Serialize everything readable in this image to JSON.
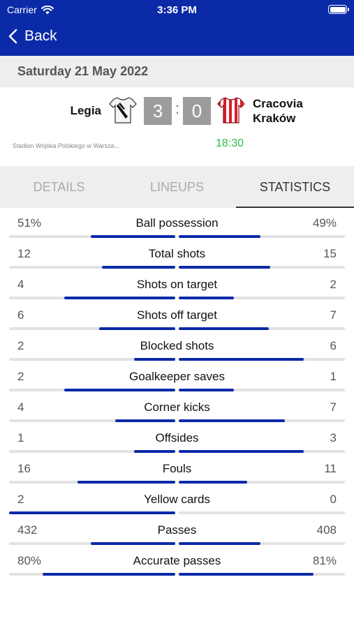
{
  "status_bar": {
    "carrier": "Carrier",
    "time": "3:36 PM"
  },
  "nav": {
    "back_label": "Back"
  },
  "match": {
    "date": "Saturday 21 May 2022",
    "home_team": "Legia",
    "away_team": "Cracovia Kraków",
    "home_score": "3",
    "away_score": "0",
    "separator": ":",
    "stadium": "Stadion Wojska Polskiego w Warsza...",
    "kickoff": "18:30"
  },
  "tabs": [
    {
      "label": "DETAILS",
      "active": false
    },
    {
      "label": "LINEUPS",
      "active": false
    },
    {
      "label": "STATISTICS",
      "active": true
    }
  ],
  "colors": {
    "brand": "#0a2aa8",
    "kickoff_green": "#2ebd4a",
    "score_box": "#9c9c9c"
  },
  "statistics": [
    {
      "label": "Ball possession",
      "home": "51%",
      "away": "49%",
      "home_bar": 0.51,
      "away_bar": 0.49
    },
    {
      "label": "Total shots",
      "home": "12",
      "away": "15",
      "home_bar": 0.44,
      "away_bar": 0.55
    },
    {
      "label": "Shots on target",
      "home": "4",
      "away": "2",
      "home_bar": 0.67,
      "away_bar": 0.33
    },
    {
      "label": "Shots off target",
      "home": "6",
      "away": "7",
      "home_bar": 0.46,
      "away_bar": 0.54
    },
    {
      "label": "Blocked shots",
      "home": "2",
      "away": "6",
      "home_bar": 0.25,
      "away_bar": 0.75
    },
    {
      "label": "Goalkeeper saves",
      "home": "2",
      "away": "1",
      "home_bar": 0.67,
      "away_bar": 0.33
    },
    {
      "label": "Corner kicks",
      "home": "4",
      "away": "7",
      "home_bar": 0.36,
      "away_bar": 0.64
    },
    {
      "label": "Offsides",
      "home": "1",
      "away": "3",
      "home_bar": 0.25,
      "away_bar": 0.75
    },
    {
      "label": "Fouls",
      "home": "16",
      "away": "11",
      "home_bar": 0.59,
      "away_bar": 0.41
    },
    {
      "label": "Yellow cards",
      "home": "2",
      "away": "0",
      "home_bar": 1.0,
      "away_bar": 0.0
    },
    {
      "label": "Passes",
      "home": "432",
      "away": "408",
      "home_bar": 0.51,
      "away_bar": 0.49
    },
    {
      "label": "Accurate passes",
      "home": "80%",
      "away": "81%",
      "home_bar": 0.8,
      "away_bar": 0.81
    }
  ]
}
